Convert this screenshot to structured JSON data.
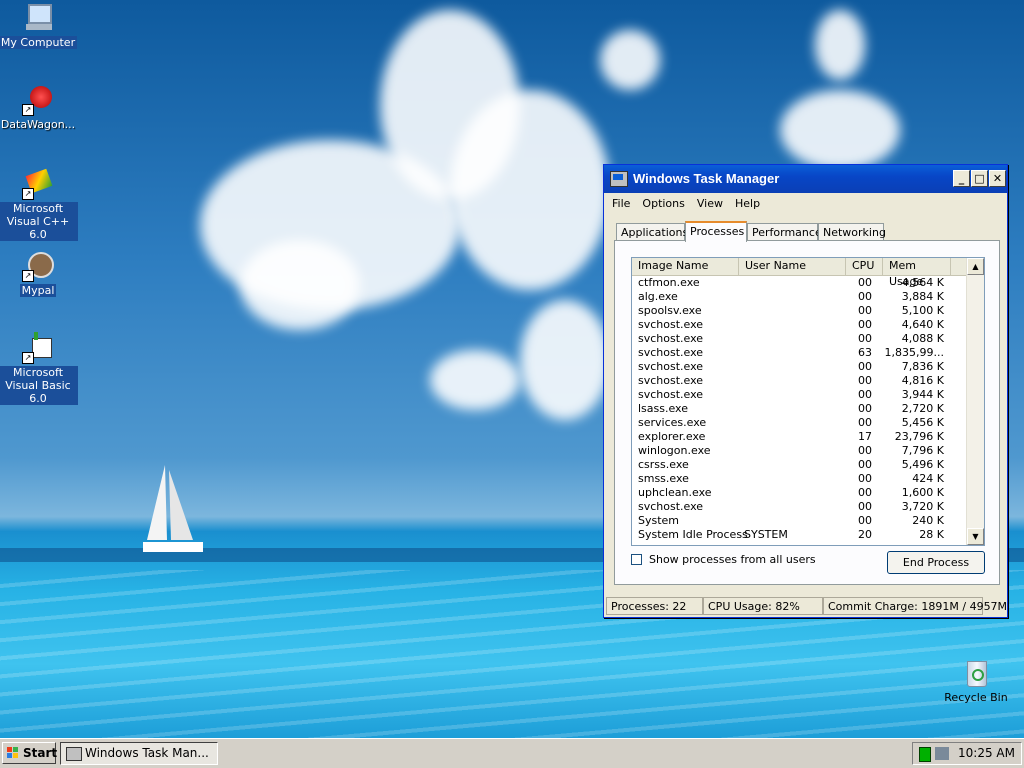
{
  "desktop_icons": [
    {
      "label": "My Computer",
      "icon": "my-computer-icon"
    },
    {
      "label": "DataWagon...",
      "icon": "datawagon-icon"
    },
    {
      "label": "Microsoft Visual C++ 6.0",
      "icon": "visual-cpp-icon"
    },
    {
      "label": "Mypal",
      "icon": "mypal-icon"
    },
    {
      "label": "Microsoft Visual Basic 6.0",
      "icon": "visual-basic-icon"
    },
    {
      "label": "Recycle Bin",
      "icon": "recycle-bin-icon"
    }
  ],
  "window": {
    "title": "Windows Task Manager",
    "menu": [
      "File",
      "Options",
      "View",
      "Help"
    ],
    "tabs": [
      "Applications",
      "Processes",
      "Performance",
      "Networking"
    ],
    "active_tab": "Processes",
    "columns": [
      "Image Name",
      "User Name",
      "CPU",
      "Mem Usage"
    ],
    "processes": [
      {
        "name": "ctfmon.exe",
        "user": "",
        "cpu": "00",
        "mem": "4,564 K"
      },
      {
        "name": "alg.exe",
        "user": "",
        "cpu": "00",
        "mem": "3,884 K"
      },
      {
        "name": "spoolsv.exe",
        "user": "",
        "cpu": "00",
        "mem": "5,100 K"
      },
      {
        "name": "svchost.exe",
        "user": "",
        "cpu": "00",
        "mem": "4,640 K"
      },
      {
        "name": "svchost.exe",
        "user": "",
        "cpu": "00",
        "mem": "4,088 K"
      },
      {
        "name": "svchost.exe",
        "user": "",
        "cpu": "63",
        "mem": "1,835,99..."
      },
      {
        "name": "svchost.exe",
        "user": "",
        "cpu": "00",
        "mem": "7,836 K"
      },
      {
        "name": "svchost.exe",
        "user": "",
        "cpu": "00",
        "mem": "4,816 K"
      },
      {
        "name": "svchost.exe",
        "user": "",
        "cpu": "00",
        "mem": "3,944 K"
      },
      {
        "name": "lsass.exe",
        "user": "",
        "cpu": "00",
        "mem": "2,720 K"
      },
      {
        "name": "services.exe",
        "user": "",
        "cpu": "00",
        "mem": "5,456 K"
      },
      {
        "name": "explorer.exe",
        "user": "",
        "cpu": "17",
        "mem": "23,796 K"
      },
      {
        "name": "winlogon.exe",
        "user": "",
        "cpu": "00",
        "mem": "7,796 K"
      },
      {
        "name": "csrss.exe",
        "user": "",
        "cpu": "00",
        "mem": "5,496 K"
      },
      {
        "name": "smss.exe",
        "user": "",
        "cpu": "00",
        "mem": "424 K"
      },
      {
        "name": "uphclean.exe",
        "user": "",
        "cpu": "00",
        "mem": "1,600 K"
      },
      {
        "name": "svchost.exe",
        "user": "",
        "cpu": "00",
        "mem": "3,720 K"
      },
      {
        "name": "System",
        "user": "",
        "cpu": "00",
        "mem": "240 K"
      },
      {
        "name": "System Idle Process",
        "user": "SYSTEM",
        "cpu": "20",
        "mem": "28 K"
      }
    ],
    "show_all_label": "Show processes from all users",
    "end_process_label": "End Process",
    "status": {
      "processes": "Processes: 22",
      "cpu": "CPU Usage: 82%",
      "commit": "Commit Charge: 1891M / 4957M"
    }
  },
  "taskbar": {
    "start_label": "Start",
    "task_label": "Windows Task Man...",
    "clock": "10:25 AM"
  },
  "colors": {
    "titlebar": "#0a5fd8",
    "selection_label_bg": "#1b4f9a",
    "tab_highlight": "#e68b2c"
  }
}
